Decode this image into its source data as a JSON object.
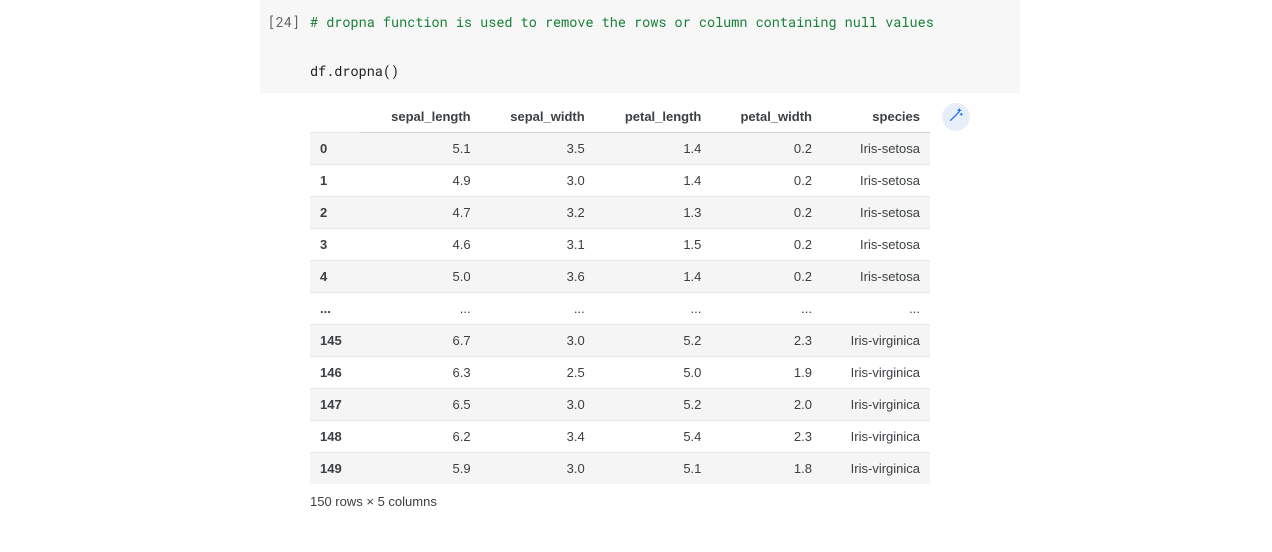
{
  "cell": {
    "execution_label": "[24]",
    "comment_line": "# dropna function is used to remove the rows or column containing null values",
    "code_line": "df.dropna()"
  },
  "table": {
    "columns": [
      "sepal_length",
      "sepal_width",
      "petal_length",
      "petal_width",
      "species"
    ],
    "rows": [
      {
        "index": "0",
        "cells": [
          "5.1",
          "3.5",
          "1.4",
          "0.2",
          "Iris-setosa"
        ]
      },
      {
        "index": "1",
        "cells": [
          "4.9",
          "3.0",
          "1.4",
          "0.2",
          "Iris-setosa"
        ]
      },
      {
        "index": "2",
        "cells": [
          "4.7",
          "3.2",
          "1.3",
          "0.2",
          "Iris-setosa"
        ]
      },
      {
        "index": "3",
        "cells": [
          "4.6",
          "3.1",
          "1.5",
          "0.2",
          "Iris-setosa"
        ]
      },
      {
        "index": "4",
        "cells": [
          "5.0",
          "3.6",
          "1.4",
          "0.2",
          "Iris-setosa"
        ]
      },
      {
        "index": "...",
        "cells": [
          "...",
          "...",
          "...",
          "...",
          "..."
        ]
      },
      {
        "index": "145",
        "cells": [
          "6.7",
          "3.0",
          "5.2",
          "2.3",
          "Iris-virginica"
        ]
      },
      {
        "index": "146",
        "cells": [
          "6.3",
          "2.5",
          "5.0",
          "1.9",
          "Iris-virginica"
        ]
      },
      {
        "index": "147",
        "cells": [
          "6.5",
          "3.0",
          "5.2",
          "2.0",
          "Iris-virginica"
        ]
      },
      {
        "index": "148",
        "cells": [
          "6.2",
          "3.4",
          "5.4",
          "2.3",
          "Iris-virginica"
        ]
      },
      {
        "index": "149",
        "cells": [
          "5.9",
          "3.0",
          "5.1",
          "1.8",
          "Iris-virginica"
        ]
      }
    ],
    "summary": "150 rows × 5 columns"
  },
  "icons": {
    "magic": "magic-wand-icon"
  }
}
